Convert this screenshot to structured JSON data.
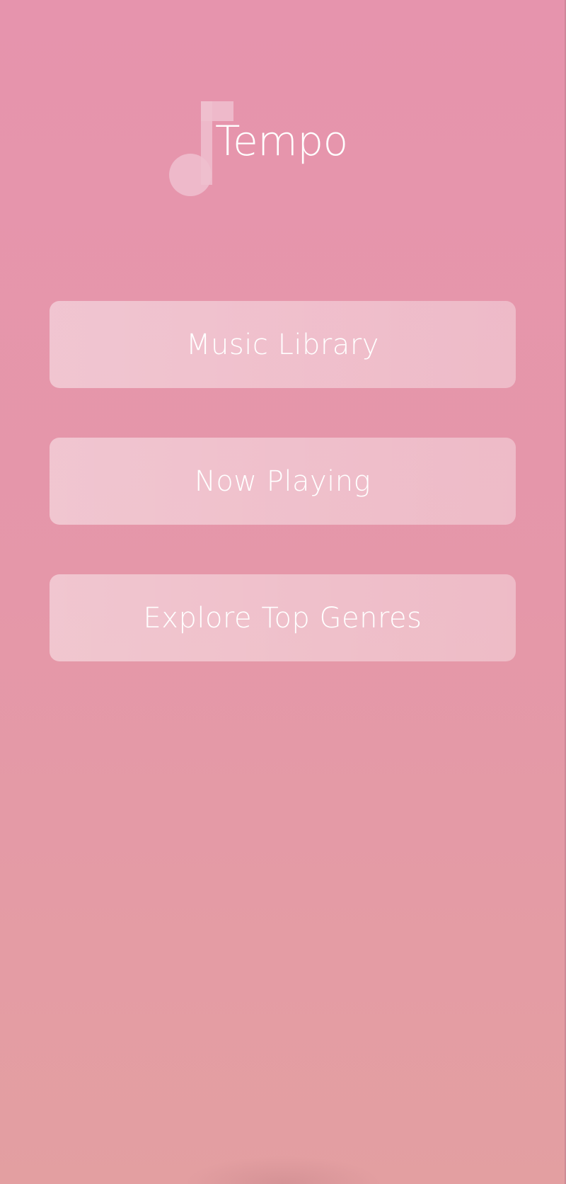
{
  "app": {
    "title": "Tempo",
    "logo_icon": "music-note-icon"
  },
  "menu": {
    "items": [
      {
        "label": "Music Library"
      },
      {
        "label": "Now Playing"
      },
      {
        "label": "Explore Top Genres"
      }
    ]
  },
  "colors": {
    "background_top": "#e694ad",
    "background_bottom": "#e39fa1",
    "button_fill": "rgba(255,255,255,0.4)",
    "text": "#ffffff"
  }
}
